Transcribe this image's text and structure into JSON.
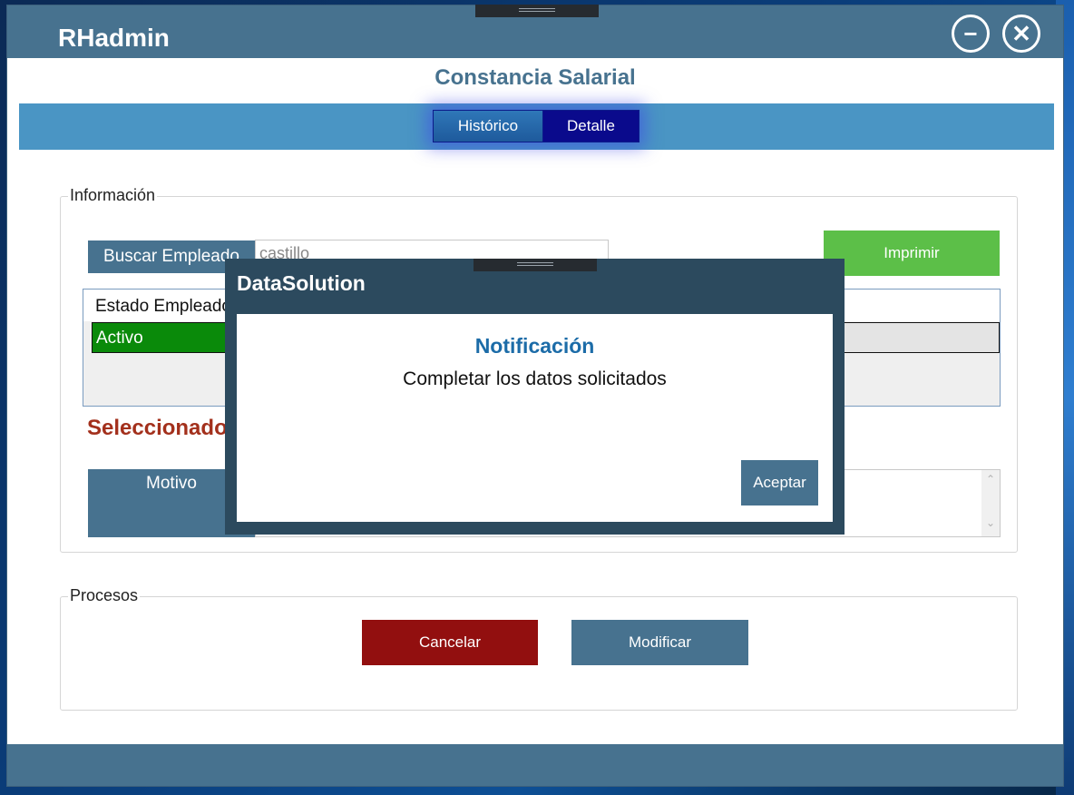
{
  "app": {
    "title": "RHadmin"
  },
  "window_buttons": {
    "minimize_icon": "minus-circle-icon",
    "close_icon": "x-circle-icon"
  },
  "page": {
    "title": "Constancia Salarial"
  },
  "tabs": [
    {
      "label": "Histórico",
      "active": false
    },
    {
      "label": "Detalle",
      "active": true
    }
  ],
  "informacion": {
    "legend": "Información",
    "search_label": "Buscar Empleado",
    "search_value": "castillo",
    "print_label": "Imprimir",
    "grid": {
      "header": "Estado Empleado",
      "rows": [
        {
          "estado": "Activo"
        }
      ]
    },
    "selected_label": "Seleccionado",
    "motivo_label": "Motivo",
    "motivo_value": ""
  },
  "procesos": {
    "legend": "Procesos",
    "cancel_label": "Cancelar",
    "modify_label": "Modificar"
  },
  "modal": {
    "title": "DataSolution",
    "heading": "Notificación",
    "message": "Completar los datos solicitados",
    "accept_label": "Aceptar"
  },
  "colors": {
    "titlebar": "#47728f",
    "tabbar": "#4a95c4",
    "print_button": "#5cbf48",
    "cancel_button": "#920f0f",
    "active_row": "#0a8a0a",
    "modal_frame": "#2c4a5e",
    "heading_blue": "#1c6ca8",
    "selected_red": "#a3301c"
  }
}
